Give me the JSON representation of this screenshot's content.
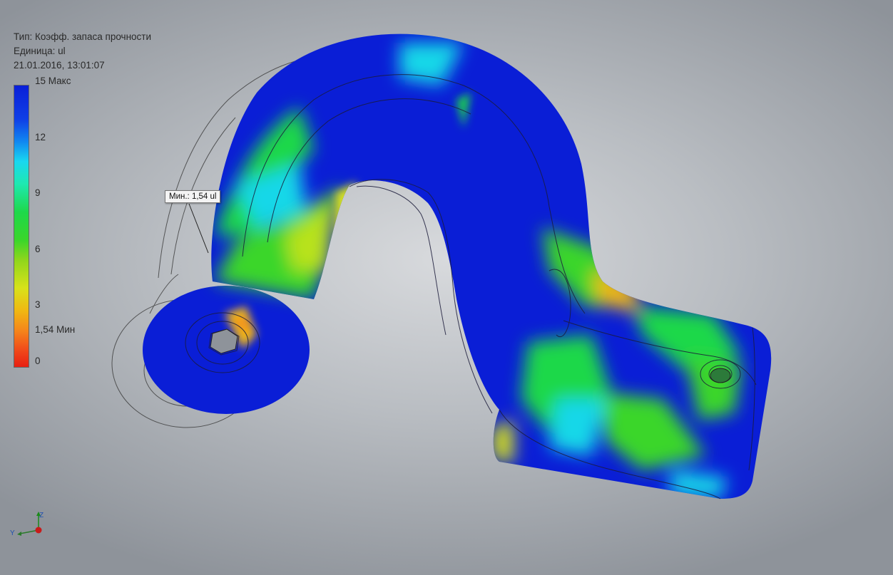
{
  "info": {
    "type_label": "Тип: Коэфф. запаса прочности",
    "unit_label": "Единица: ul",
    "timestamp": "21.01.2016, 13:01:07"
  },
  "legend": {
    "ticks": {
      "max": "15 Макс",
      "t12": "12",
      "t9": "9",
      "t6": "6",
      "t3": "3",
      "min": "1,54 Мин",
      "t0": "0"
    },
    "colors": [
      "#0a1fd8",
      "#1188f0",
      "#19d7f0",
      "#1ed84a",
      "#d8e21a",
      "#f5861a",
      "#e81f12"
    ]
  },
  "probe": {
    "label": "Мин.: 1,54 ul"
  },
  "triad": {
    "z": "Z",
    "y": "Y"
  },
  "icons": {
    "triad": "view-triad-icon"
  }
}
